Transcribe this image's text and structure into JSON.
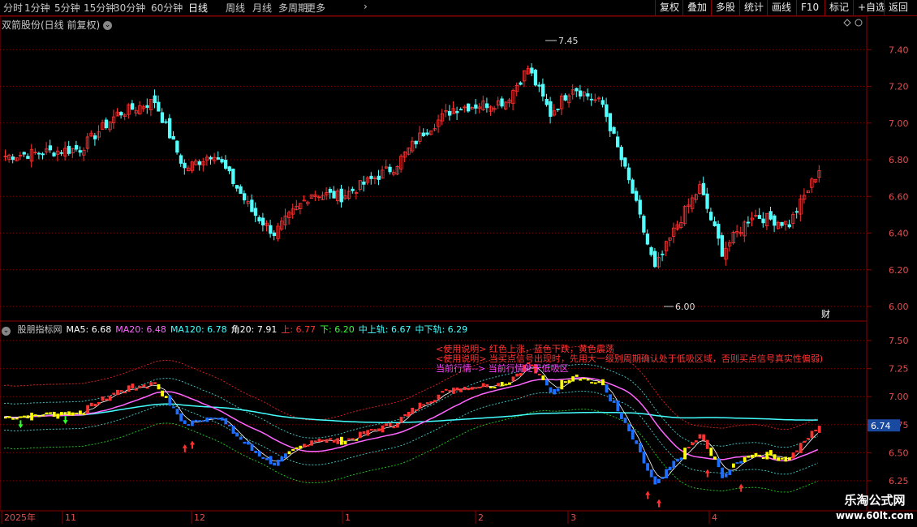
{
  "toolbar": {
    "period_tabs": [
      "分时",
      "1分钟",
      "5分钟",
      "15分钟",
      "30分钟",
      "60分钟",
      "日线",
      "周线",
      "月线",
      "多周期",
      "更多"
    ],
    "active_tab": "日线",
    "right_buttons": [
      "复权",
      "叠加",
      "多股",
      "统计",
      "画线",
      "F10",
      "标记",
      "+自选",
      "返回"
    ]
  },
  "main_chart": {
    "title": "双箭股份(日线 前复权)",
    "y_ticks": [
      "7.40",
      "7.20",
      "7.00",
      "6.80",
      "6.60",
      "6.40",
      "6.20",
      "6.00"
    ],
    "high_marker": "7.45",
    "low_marker": "6.00",
    "cai_label": "财"
  },
  "indicator": {
    "name": "股朋指标网",
    "legend": [
      {
        "label": "MA5: 6.68",
        "color": "#ffffff"
      },
      {
        "label": "MA20: 6.48",
        "color": "#ff66ff"
      },
      {
        "label": "MA120: 6.78",
        "color": "#44ffff"
      },
      {
        "label": "角20: 7.91",
        "color": "#ffffff"
      },
      {
        "label": "上: 6.77",
        "color": "#ff3333"
      },
      {
        "label": "下: 6.20",
        "color": "#33ff33"
      },
      {
        "label": "中上轨: 6.67",
        "color": "#44ffff"
      },
      {
        "label": "中下轨: 6.29",
        "color": "#44ffff"
      }
    ],
    "notes": [
      {
        "text": "<使用说明> 红色上涨，蓝色下跌，黄色震荡",
        "color": "#ff3333"
      },
      {
        "text": "<使用说明> 当买点信号出现时，先用大一级别周期确认处于低吸区域，否则买点信号真实性偏弱)",
        "color": "#ff3333"
      },
      {
        "text": "当前行情--> 当前行情处于低吸区",
        "color": "#ff44ff"
      }
    ],
    "y_ticks": [
      "7.50",
      "7.25",
      "7.00",
      "6.75",
      "6.50",
      "6.25"
    ],
    "current_value": "6.74"
  },
  "time_axis": [
    "2025年",
    "11",
    "12",
    "1",
    "2",
    "3",
    "4"
  ],
  "watermark": {
    "title": "乐淘公式网",
    "url": "www.60lt.com"
  },
  "colors": {
    "up": "#ff3232",
    "down": "#54ffff",
    "bg": "#000000",
    "grid": "#8b0000",
    "flat": "#ffff00",
    "blue": "#1e6fff"
  }
}
